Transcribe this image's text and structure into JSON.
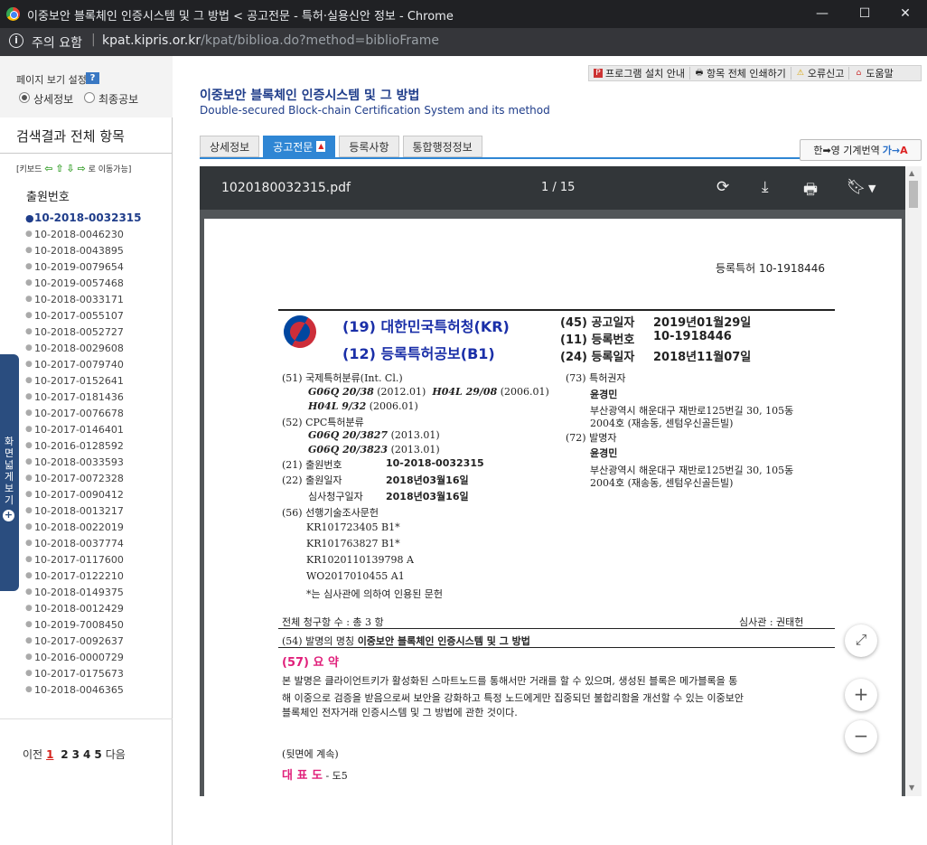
{
  "window": {
    "title": "이중보안 블록체인 인증시스템 및 그 방법 < 공고전문 - 특허·실용신안 정보 - Chrome",
    "min": "—",
    "max": "☐",
    "close": "✕"
  },
  "address": {
    "warning": "주의 요함",
    "host": "kpat.kipris.or.kr",
    "path": "/kpat/biblioa.do?method=biblioFrame"
  },
  "left": {
    "view_setting_label": "페이지 보기 설정",
    "help": "?",
    "radio_detail": "상세정보",
    "radio_final": "최종공보",
    "results_header": "검색결과 전체 항목",
    "keys_prefix": "[키보드",
    "keys_suffix": "로 이동가능]",
    "appno_header": "출원번호",
    "side_tab": "화면넓게보기",
    "apps": [
      "10-2018-0032315",
      "10-2018-0046230",
      "10-2018-0043895",
      "10-2019-0079654",
      "10-2019-0057468",
      "10-2018-0033171",
      "10-2017-0055107",
      "10-2018-0052727",
      "10-2018-0029608",
      "10-2017-0079740",
      "10-2017-0152641",
      "10-2017-0181436",
      "10-2017-0076678",
      "10-2017-0146401",
      "10-2016-0128592",
      "10-2018-0033593",
      "10-2017-0072328",
      "10-2017-0090412",
      "10-2018-0013217",
      "10-2018-0022019",
      "10-2018-0037774",
      "10-2017-0117600",
      "10-2017-0122210",
      "10-2018-0149375",
      "10-2018-0012429",
      "10-2019-7008450",
      "10-2017-0092637",
      "10-2016-0000729",
      "10-2017-0175673",
      "10-2018-0046365"
    ],
    "pager": {
      "prev": "이전",
      "pages": [
        "1",
        "2",
        "3",
        "4",
        "5"
      ],
      "next": "다음"
    }
  },
  "header": {
    "links": [
      "프로그램 설치 안내",
      "항목 전체 인쇄하기",
      "오류신고",
      "도움말"
    ],
    "title_ko": "이중보안 블록체인 인증시스템 및 그 방법",
    "title_en": "Double-secured Block-chain Certification System and its method",
    "tabs": [
      "상세정보",
      "공고전문",
      "등록사항",
      "통합행정정보"
    ],
    "translate": "한➡영 기계번역"
  },
  "pdf": {
    "filename": "1020180032315.pdf",
    "page": "1 / 15",
    "doc": {
      "reg_no_top": "등록특허  10-1918446",
      "office": "(19) 대한민국특허청(KR)",
      "kind": "(12) 등록특허공보(B1)",
      "r45": "(45) 공고일자",
      "r45v": "2019년01월29일",
      "r11": "(11) 등록번호",
      "r11v": "10-1918446",
      "r24": "(24) 등록일자",
      "r24v": "2018년11월07일",
      "l51": "(51) 국제특허분류(Int. Cl.)",
      "ipc1a": "G06Q 20/38",
      "ipc1b": "(2012.01)",
      "ipc2a": "H04L 29/08",
      "ipc2b": "(2006.01)",
      "ipc3a": "H04L 9/32",
      "ipc3b": "(2006.01)",
      "l52": "(52) CPC특허분류",
      "cpc1a": "G06Q 20/3827",
      "cpc1b": "(2013.01)",
      "cpc2a": "G06Q 20/3823",
      "cpc2b": "(2013.01)",
      "l21": "(21) 출원번호",
      "l21v": "10-2018-0032315",
      "l22": "(22) 출원일자",
      "l22v": "2018년03월16일",
      "exam": "심사청구일자",
      "examv": "2018년03월16일",
      "l56": "(56) 선행기술조사문헌",
      "prior": [
        "KR101723405 B1*",
        "KR101763827 B1*",
        "KR1020110139798 A",
        "WO2017010455 A1"
      ],
      "prior_note": "*는 심사관에 의하여 인용된 문헌",
      "r73": "(73) 특허권자",
      "r73n": "윤경민",
      "r73a1": "부산광역시 해운대구 재반로125번길 30, 105동",
      "r73a2": "2004호 (재송동, 센텀우신골든빌)",
      "r72": "(72) 발명자",
      "r72n": "윤경민",
      "r72a1": "부산광역시 해운대구 재반로125번길 30, 105동",
      "r72a2": "2004호 (재송동, 센텀우신골든빌)",
      "claims": "전체 청구항 수 : 총  3  항",
      "examiner": "심사관 :    권태헌",
      "l54": "(54) 발명의 명칭",
      "l54v": "이중보안 블록체인 인증시스템 및 그 방법",
      "l57": "(57) 요 약",
      "abs1": "본 발명은 클라이언트키가 활성화된 스마트노드를 통해서만 거래를 할 수 있으며, 생성된 블록은 메가블록을 통",
      "abs2": "해 이중으로 검증을 받음으로써 보안을 강화하고 특정 노드에게만 집중되던 불합리함을 개선할 수 있는 이중보안",
      "abs3": "블록체인 전자거래 인증시스템 및 그 방법에 관한 것이다.",
      "cont": "(뒷면에 계속)",
      "rep": "대 표 도",
      "repv": "- 도5"
    }
  }
}
